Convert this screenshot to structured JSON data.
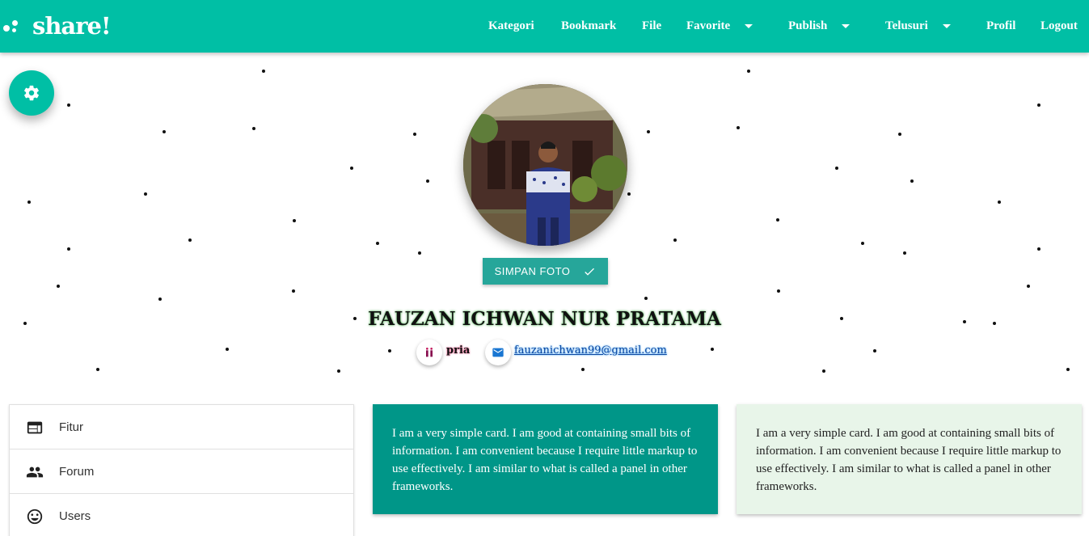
{
  "brand": {
    "name": "share!"
  },
  "nav": {
    "items": [
      {
        "label": "Kategori",
        "dropdown": false
      },
      {
        "label": "Bookmark",
        "dropdown": false
      },
      {
        "label": "File",
        "dropdown": false
      },
      {
        "label": "Favorite",
        "dropdown": true
      },
      {
        "label": "Publish",
        "dropdown": true
      },
      {
        "label": "Telusuri",
        "dropdown": true
      },
      {
        "label": "Profil",
        "dropdown": false
      },
      {
        "label": "Logout",
        "dropdown": false
      }
    ]
  },
  "profile": {
    "save_photo_label": "SIMPAN FOTO",
    "name": "FAUZAN ICHWAN NUR PRATAMA",
    "gender": "pria",
    "email": "fauzanichwan99@gmail.com"
  },
  "sidebar": {
    "items": [
      {
        "label": "Fitur",
        "icon": "web-icon"
      },
      {
        "label": "Forum",
        "icon": "people-icon"
      },
      {
        "label": "Users",
        "icon": "smiley-icon"
      }
    ]
  },
  "cards": [
    {
      "text": "I am a very simple card. I am good at containing small bits of information. I am convenient because I require little markup to use effectively. I am similar to what is called a panel in other frameworks."
    },
    {
      "text": "I am a very simple card. I am good at containing small bits of information. I am convenient because I require little markup to use effectively. I am similar to what is called a panel in other frameworks."
    }
  ],
  "colors": {
    "primary": "#00bfa5",
    "teal_card": "#009688",
    "save_button": "#26a69a",
    "light_card": "#e8f5e9"
  }
}
